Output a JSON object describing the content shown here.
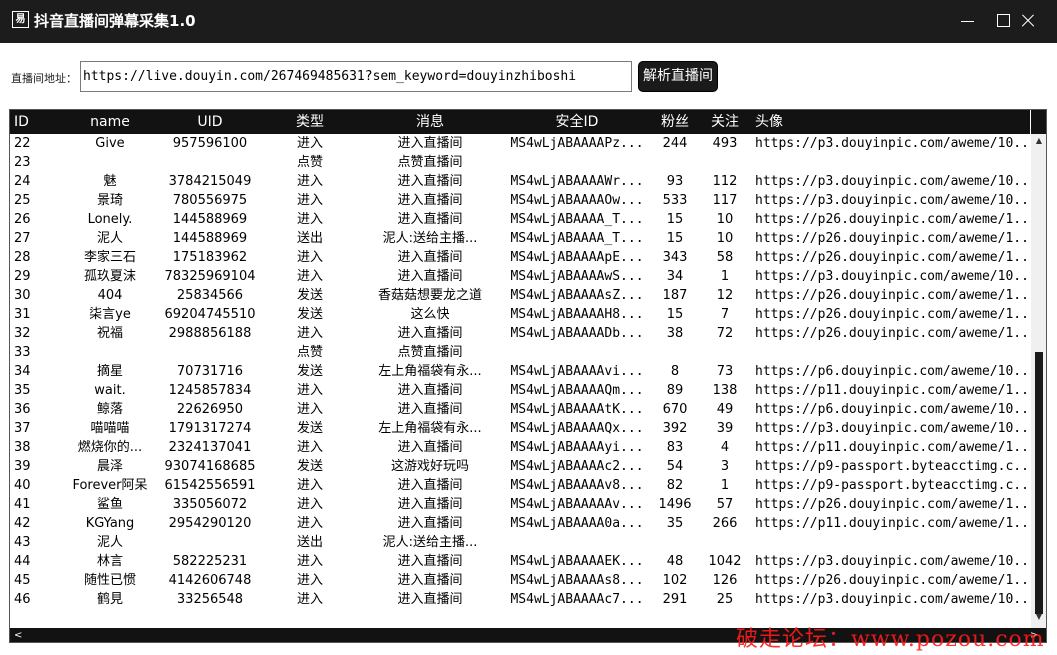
{
  "window": {
    "title": "抖音直播间弹幕采集1.0",
    "icon_glyph": "易"
  },
  "address": {
    "label": "直播间地址：",
    "value": "https://live.douyin.com/267469485631?sem_keyword=douyinzhiboshi",
    "parse_button": "解析直播间"
  },
  "grid": {
    "columns": [
      "ID",
      "name",
      "UID",
      "类型",
      "消息",
      "安全ID",
      "粉丝",
      "关注",
      "头像"
    ],
    "rows": [
      [
        "22",
        "Give",
        "957596100",
        "进入",
        "进入直播间",
        "MS4wLjABAAAAPz...",
        "244",
        "493",
        "https://p3.douyinpic.com/aweme/10..."
      ],
      [
        "23",
        "",
        "",
        "点赞",
        "点赞直播间",
        "",
        "",
        "",
        ""
      ],
      [
        "24",
        "魅",
        "3784215049",
        "进入",
        "进入直播间",
        "MS4wLjABAAAAWr...",
        "93",
        "112",
        "https://p3.douyinpic.com/aweme/10..."
      ],
      [
        "25",
        "景琦",
        "780556975",
        "进入",
        "进入直播间",
        "MS4wLjABAAAAOw...",
        "533",
        "117",
        "https://p3.douyinpic.com/aweme/10..."
      ],
      [
        "26",
        "Lonely.",
        "144588969",
        "进入",
        "进入直播间",
        "MS4wLjABAAAA_T...",
        "15",
        "10",
        "https://p26.douyinpic.com/aweme/1..."
      ],
      [
        "27",
        "泥人",
        "144588969",
        "送出",
        "泥人:送给主播...",
        "MS4wLjABAAAA_T...",
        "15",
        "10",
        "https://p26.douyinpic.com/aweme/1..."
      ],
      [
        "28",
        "李家三石",
        "175183962",
        "进入",
        "进入直播间",
        "MS4wLjABAAAApE...",
        "343",
        "58",
        "https://p26.douyinpic.com/aweme/1..."
      ],
      [
        "29",
        "孤玖夏沫",
        "78325969104",
        "进入",
        "进入直播间",
        "MS4wLjABAAAAwS...",
        "34",
        "1",
        "https://p3.douyinpic.com/aweme/10..."
      ],
      [
        "30",
        "404",
        "25834566",
        "发送",
        "香菇菇想要龙之道",
        "MS4wLjABAAAAsZ...",
        "187",
        "12",
        "https://p26.douyinpic.com/aweme/1..."
      ],
      [
        "31",
        "柒言ye",
        "69204745510",
        "发送",
        "这么快",
        "MS4wLjABAAAAH8...",
        "15",
        "7",
        "https://p26.douyinpic.com/aweme/1..."
      ],
      [
        "32",
        "祝福",
        "2988856188",
        "进入",
        "进入直播间",
        "MS4wLjABAAAADb...",
        "38",
        "72",
        "https://p26.douyinpic.com/aweme/1..."
      ],
      [
        "33",
        "",
        "",
        "点赞",
        "点赞直播间",
        "",
        "",
        "",
        ""
      ],
      [
        "34",
        "摘星",
        "70731716",
        "发送",
        "左上角福袋有永...",
        "MS4wLjABAAAAvi...",
        "8",
        "73",
        "https://p6.douyinpic.com/aweme/10..."
      ],
      [
        "35",
        "wait.",
        "1245857834",
        "进入",
        "进入直播间",
        "MS4wLjABAAAAQm...",
        "89",
        "138",
        "https://p11.douyinpic.com/aweme/1..."
      ],
      [
        "36",
        "鲸落",
        "22626950",
        "进入",
        "进入直播间",
        "MS4wLjABAAAAtK...",
        "670",
        "49",
        "https://p6.douyinpic.com/aweme/10..."
      ],
      [
        "37",
        "喵喵喵",
        "1791317274",
        "发送",
        "左上角福袋有永...",
        "MS4wLjABAAAAQx...",
        "392",
        "39",
        "https://p3.douyinpic.com/aweme/10..."
      ],
      [
        "38",
        "燃烧你的...",
        "2324137041",
        "进入",
        "进入直播间",
        "MS4wLjABAAAAyi...",
        "83",
        "4",
        "https://p11.douyinpic.com/aweme/1..."
      ],
      [
        "39",
        "晨泽",
        "93074168685",
        "发送",
        "这游戏好玩吗",
        "MS4wLjABAAAAc2...",
        "54",
        "3",
        "https://p9-passport.byteacctimg.c..."
      ],
      [
        "40",
        "Forever阿呆",
        "61542556591",
        "进入",
        "进入直播间",
        "MS4wLjABAAAAv8...",
        "82",
        "1",
        "https://p9-passport.byteacctimg.c..."
      ],
      [
        "41",
        "鲨鱼",
        "335056072",
        "进入",
        "进入直播间",
        "MS4wLjABAAAAAv...",
        "1496",
        "57",
        "https://p26.douyinpic.com/aweme/1..."
      ],
      [
        "42",
        "KGYang",
        "2954290120",
        "进入",
        "进入直播间",
        "MS4wLjABAAAA0a...",
        "35",
        "266",
        "https://p11.douyinpic.com/aweme/1..."
      ],
      [
        "43",
        "泥人",
        "",
        "送出",
        "泥人:送给主播...",
        "",
        "",
        "",
        ""
      ],
      [
        "44",
        "林言",
        "582225231",
        "进入",
        "进入直播间",
        "MS4wLjABAAAAEK...",
        "48",
        "1042",
        "https://p3.douyinpic.com/aweme/10..."
      ],
      [
        "45",
        "随性已惯",
        "4142606748",
        "进入",
        "进入直播间",
        "MS4wLjABAAAAs8...",
        "102",
        "126",
        "https://p26.douyinpic.com/aweme/1..."
      ],
      [
        "46",
        "鹤見",
        "33256548",
        "进入",
        "进入直播间",
        "MS4wLjABAAAAc7...",
        "291",
        "25",
        "https://p3.douyinpic.com/aweme/10..."
      ]
    ]
  },
  "watermark": "破走论坛：www.pozou.com",
  "colors": {
    "titlebar": "#1c1c1c",
    "header": "#121212",
    "watermark": "#ff1a1a"
  }
}
